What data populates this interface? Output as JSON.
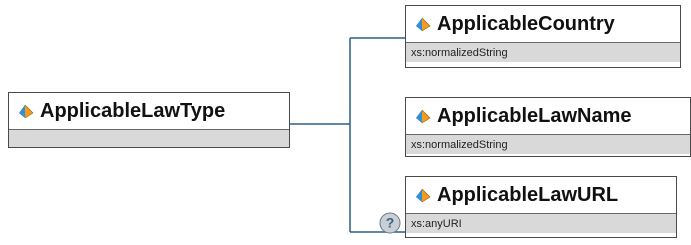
{
  "diagram": {
    "root": {
      "name": "ApplicableLawType",
      "icon": "element-icon"
    },
    "children": [
      {
        "name": "ApplicableCountry",
        "type": "xs:normalizedString",
        "icon": "element-icon",
        "optional": false
      },
      {
        "name": "ApplicableLawName",
        "type": "xs:normalizedString",
        "icon": "element-icon",
        "optional": false
      },
      {
        "name": "ApplicableLawURL",
        "type": "xs:anyURI",
        "icon": "element-icon",
        "optional": true,
        "optional_marker": "?"
      }
    ],
    "colors": {
      "connector": "#2a5f87",
      "type_bar": "#d9d9d9",
      "border": "#4a4a4a",
      "icon_blue": "#2f8fd8",
      "icon_orange": "#f39b1f",
      "optional_badge": "#c9cfd6"
    }
  }
}
